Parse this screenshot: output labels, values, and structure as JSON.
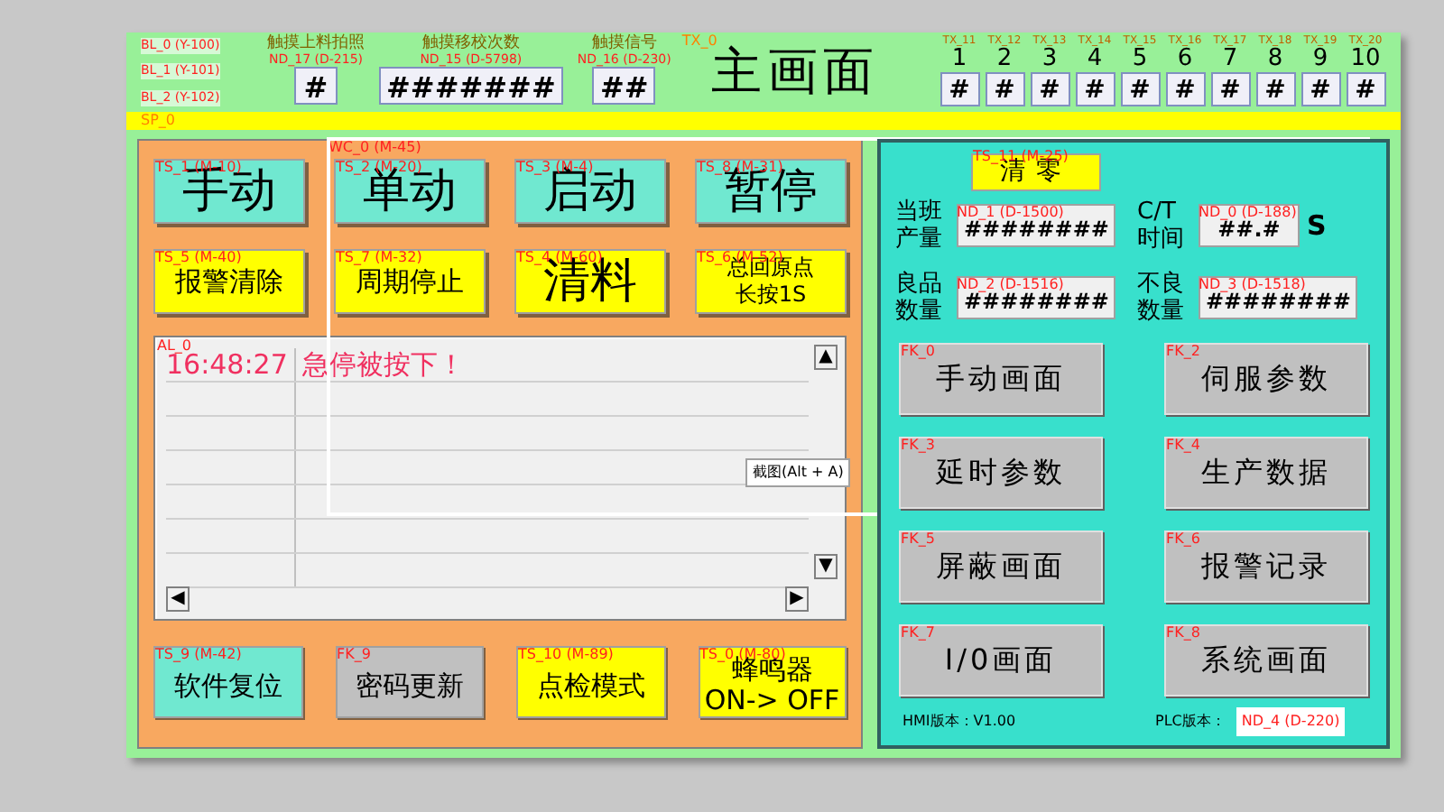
{
  "lamps": [
    {
      "tag": "BL_0 (Y-100)"
    },
    {
      "tag": "BL_1 (Y-101)"
    },
    {
      "tag": "BL_2 (Y-102)"
    }
  ],
  "header_fields": [
    {
      "caption": "触摸上料拍照",
      "tag": "ND_17 (D-215)",
      "value": "#"
    },
    {
      "caption": "触摸移校次数",
      "tag": "ND_15 (D-5798)",
      "value": "#######"
    },
    {
      "caption": "触摸信号",
      "tag": "ND_16 (D-230)",
      "value": "##"
    }
  ],
  "title": {
    "tag": "TX_0",
    "text": "主画面"
  },
  "stations": [
    {
      "tag": "TX_11",
      "label": "1",
      "value": "#"
    },
    {
      "tag": "TX_12",
      "label": "2",
      "value": "#"
    },
    {
      "tag": "TX_13",
      "label": "3",
      "value": "#"
    },
    {
      "tag": "TX_14",
      "label": "4",
      "value": "#"
    },
    {
      "tag": "TX_15",
      "label": "5",
      "value": "#"
    },
    {
      "tag": "TX_16",
      "label": "6",
      "value": "#"
    },
    {
      "tag": "TX_17",
      "label": "7",
      "value": "#"
    },
    {
      "tag": "TX_18",
      "label": "8",
      "value": "#"
    },
    {
      "tag": "TX_19",
      "label": "9",
      "value": "#"
    },
    {
      "tag": "TX_20",
      "label": "10",
      "value": "#"
    }
  ],
  "banner": {
    "tag": "SP_0"
  },
  "left_panel": {
    "window_tag": "WC_0 (M-45)",
    "buttons": [
      {
        "tag": "TS_1 (M-10)",
        "label": "手动",
        "color": "#70e8d0"
      },
      {
        "tag": "TS_2 (M-20)",
        "label": "单动",
        "color": "#70e8d0"
      },
      {
        "tag": "TS_3 (M-4)",
        "label": "启动",
        "color": "#70e8d0"
      },
      {
        "tag": "TS_8 (M-31)",
        "label": "暂停",
        "color": "#70e8d0"
      },
      {
        "tag": "TS_5 (M-40)",
        "label": "报警清除",
        "color": "#ffff00"
      },
      {
        "tag": "TS_7 (M-32)",
        "label": "周期停止",
        "color": "#ffff00"
      },
      {
        "tag": "TS_4 (M-60)",
        "label": "清料",
        "color": "#ffff00"
      },
      {
        "tag": "TS_6 (M-52)",
        "label": "总回原点长按1S",
        "color": "#ffff00"
      }
    ],
    "alarm_list": {
      "tag": "AL_0",
      "rows": [
        {
          "time": "16:48:27",
          "message": "急停被按下！"
        }
      ],
      "scroll_arrows": {
        "up": "▲",
        "down": "▼",
        "left": "◀",
        "right": "▶"
      }
    },
    "bottom_buttons": [
      {
        "tag": "TS_9 (M-42)",
        "label": "软件复位",
        "color": "#70e8d0"
      },
      {
        "tag": "FK_9",
        "label": "密码更新",
        "color": "#c0c0c0"
      },
      {
        "tag": "TS_10 (M-89)",
        "label": "点检模式",
        "color": "#ffff00"
      },
      {
        "tag": "TS_0 (M-80)",
        "label": "蜂鸣器\nON-> OFF",
        "color": "#ffff00"
      }
    ]
  },
  "tooltip": "截图(Alt + A)",
  "right_panel": {
    "clear_button": {
      "tag": "TS_11 (M-25)",
      "label": "清零"
    },
    "readouts": [
      {
        "label": "当班产量",
        "tag": "ND_1 (D-1500)",
        "value": "########"
      },
      {
        "label": "C/T 时间",
        "tag": "ND_0 (D-188)",
        "value": "##.#",
        "unit": "S"
      },
      {
        "label": "良品数量",
        "tag": "ND_2 (D-1516)",
        "value": "########"
      },
      {
        "label": "不良数量",
        "tag": "ND_3 (D-1518)",
        "value": "########"
      }
    ],
    "screen_buttons": [
      {
        "tag": "FK_0",
        "label": "手动画面"
      },
      {
        "tag": "FK_2",
        "label": "伺服参数"
      },
      {
        "tag": "FK_3",
        "label": "延时参数"
      },
      {
        "tag": "FK_4",
        "label": "生产数据"
      },
      {
        "tag": "FK_5",
        "label": "屏蔽画面"
      },
      {
        "tag": "FK_6",
        "label": "报警记录"
      },
      {
        "tag": "FK_7",
        "label": "I/0画面"
      },
      {
        "tag": "FK_8",
        "label": "系统画面"
      }
    ],
    "hmi_version": "HMI版本：V1.00",
    "plc_version_label": "PLC版本：",
    "plc_version_tag": "ND_4 (D-220)"
  }
}
